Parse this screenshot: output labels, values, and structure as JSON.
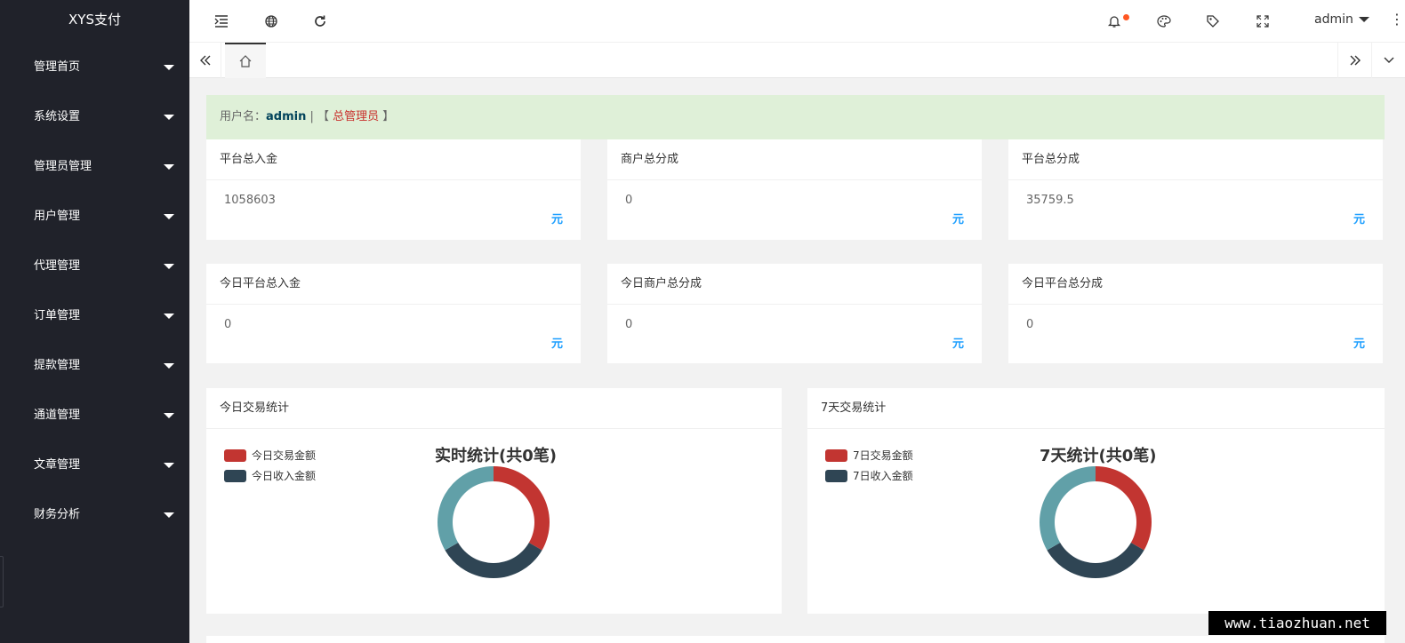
{
  "app": {
    "logo": "XYS支付"
  },
  "sidebar": {
    "items": [
      {
        "label": "管理首页"
      },
      {
        "label": "系统设置"
      },
      {
        "label": "管理员管理"
      },
      {
        "label": "用户管理"
      },
      {
        "label": "代理管理"
      },
      {
        "label": "订单管理"
      },
      {
        "label": "提款管理"
      },
      {
        "label": "通道管理"
      },
      {
        "label": "文章管理"
      },
      {
        "label": "财务分析"
      }
    ]
  },
  "header": {
    "username": "admin",
    "icons": [
      "menu-fold-icon",
      "globe-icon",
      "refresh-icon",
      "bell-icon",
      "palette-icon",
      "tag-icon",
      "fullscreen-icon",
      "more-vertical-icon"
    ],
    "notification_dot_color": "#ff5722"
  },
  "welcome": {
    "prefix": "用户名：",
    "username": "admin",
    "sep": " | ",
    "bracket_open": "【 ",
    "role": "总管理员",
    "bracket_close": " 】"
  },
  "stats": [
    {
      "title": "平台总入金",
      "value": "1058603",
      "unit": "元"
    },
    {
      "title": "商户总分成",
      "value": "0",
      "unit": "元"
    },
    {
      "title": "平台总分成",
      "value": "35759.5",
      "unit": "元"
    },
    {
      "title": "今日平台总入金",
      "value": "0",
      "unit": "元"
    },
    {
      "title": "今日商户总分成",
      "value": "0",
      "unit": "元"
    },
    {
      "title": "今日平台总分成",
      "value": "0",
      "unit": "元"
    }
  ],
  "charts": [
    {
      "panel_title": "今日交易统计",
      "chart_title": "实时统计(共0笔)",
      "legend": [
        {
          "name": "今日交易金额",
          "color": "#c23531"
        },
        {
          "name": "今日收入金额",
          "color": "#2f4554"
        }
      ]
    },
    {
      "panel_title": "7天交易统计",
      "chart_title": "7天统计(共0笔)",
      "legend": [
        {
          "name": "7日交易金额",
          "color": "#c23531"
        },
        {
          "name": "7日收入金额",
          "color": "#2f4554"
        }
      ]
    }
  ],
  "chart_data": [
    {
      "type": "pie",
      "title": "实时统计(共0笔)",
      "categories": [
        "今日交易金额",
        "今日收入金额",
        ""
      ],
      "values": [
        1,
        1,
        1
      ],
      "colors": [
        "#c23531",
        "#2f4554",
        "#61a0a8"
      ]
    },
    {
      "type": "pie",
      "title": "7天统计(共0笔)",
      "categories": [
        "7日交易金额",
        "7日收入金额",
        ""
      ],
      "values": [
        1,
        1,
        1
      ],
      "colors": [
        "#c23531",
        "#2f4554",
        "#61a0a8"
      ]
    }
  ],
  "watermark": "www.tiaozhuan.net"
}
